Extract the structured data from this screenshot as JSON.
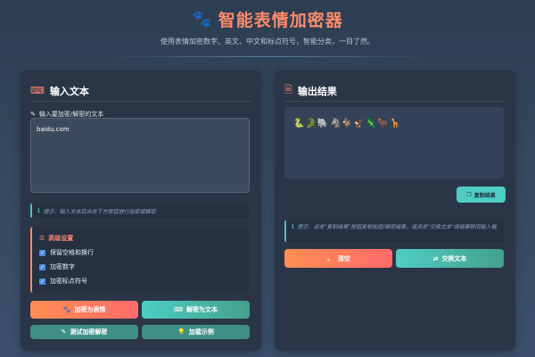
{
  "header": {
    "icon": "paw-icon",
    "title": "智能表情加密器",
    "subtitle": "使用表情加密数字、英文、中文和标点符号，智能分类，一目了然。"
  },
  "input_panel": {
    "icon": "keyboard-icon",
    "title": "输入文本",
    "field_label": "输入要加密/解密的文本",
    "field_value": "baidu.com",
    "hint": "提示：输入文本后点击下方按钮进行加密或解密",
    "advanced": {
      "title": "高级设置",
      "options": [
        {
          "label": "保留空格和换行",
          "checked": true
        },
        {
          "label": "加密数字",
          "checked": true
        },
        {
          "label": "加密标点符号",
          "checked": true
        }
      ]
    },
    "buttons": {
      "encrypt": "加密为表情",
      "decrypt": "解密为文本",
      "test": "测试加密解密",
      "example": "加载示例"
    }
  },
  "output_panel": {
    "icon": "file-code-icon",
    "title": "输出结果",
    "result": "🐍🐊🐘🦓🐐🦅🦎🐂🦒",
    "copy_label": "复制结果",
    "hint": "提示：点击\"复制结果\"按钮复制加密/解密结果，或点击\"交换文本\"将结果移回输入框",
    "clear_label": "清空",
    "swap_label": "交换文本"
  },
  "colors": {
    "accent_orange": "#ff8a6a",
    "accent_teal": "#4ecdc4",
    "panel_bg": "#2a3647"
  }
}
